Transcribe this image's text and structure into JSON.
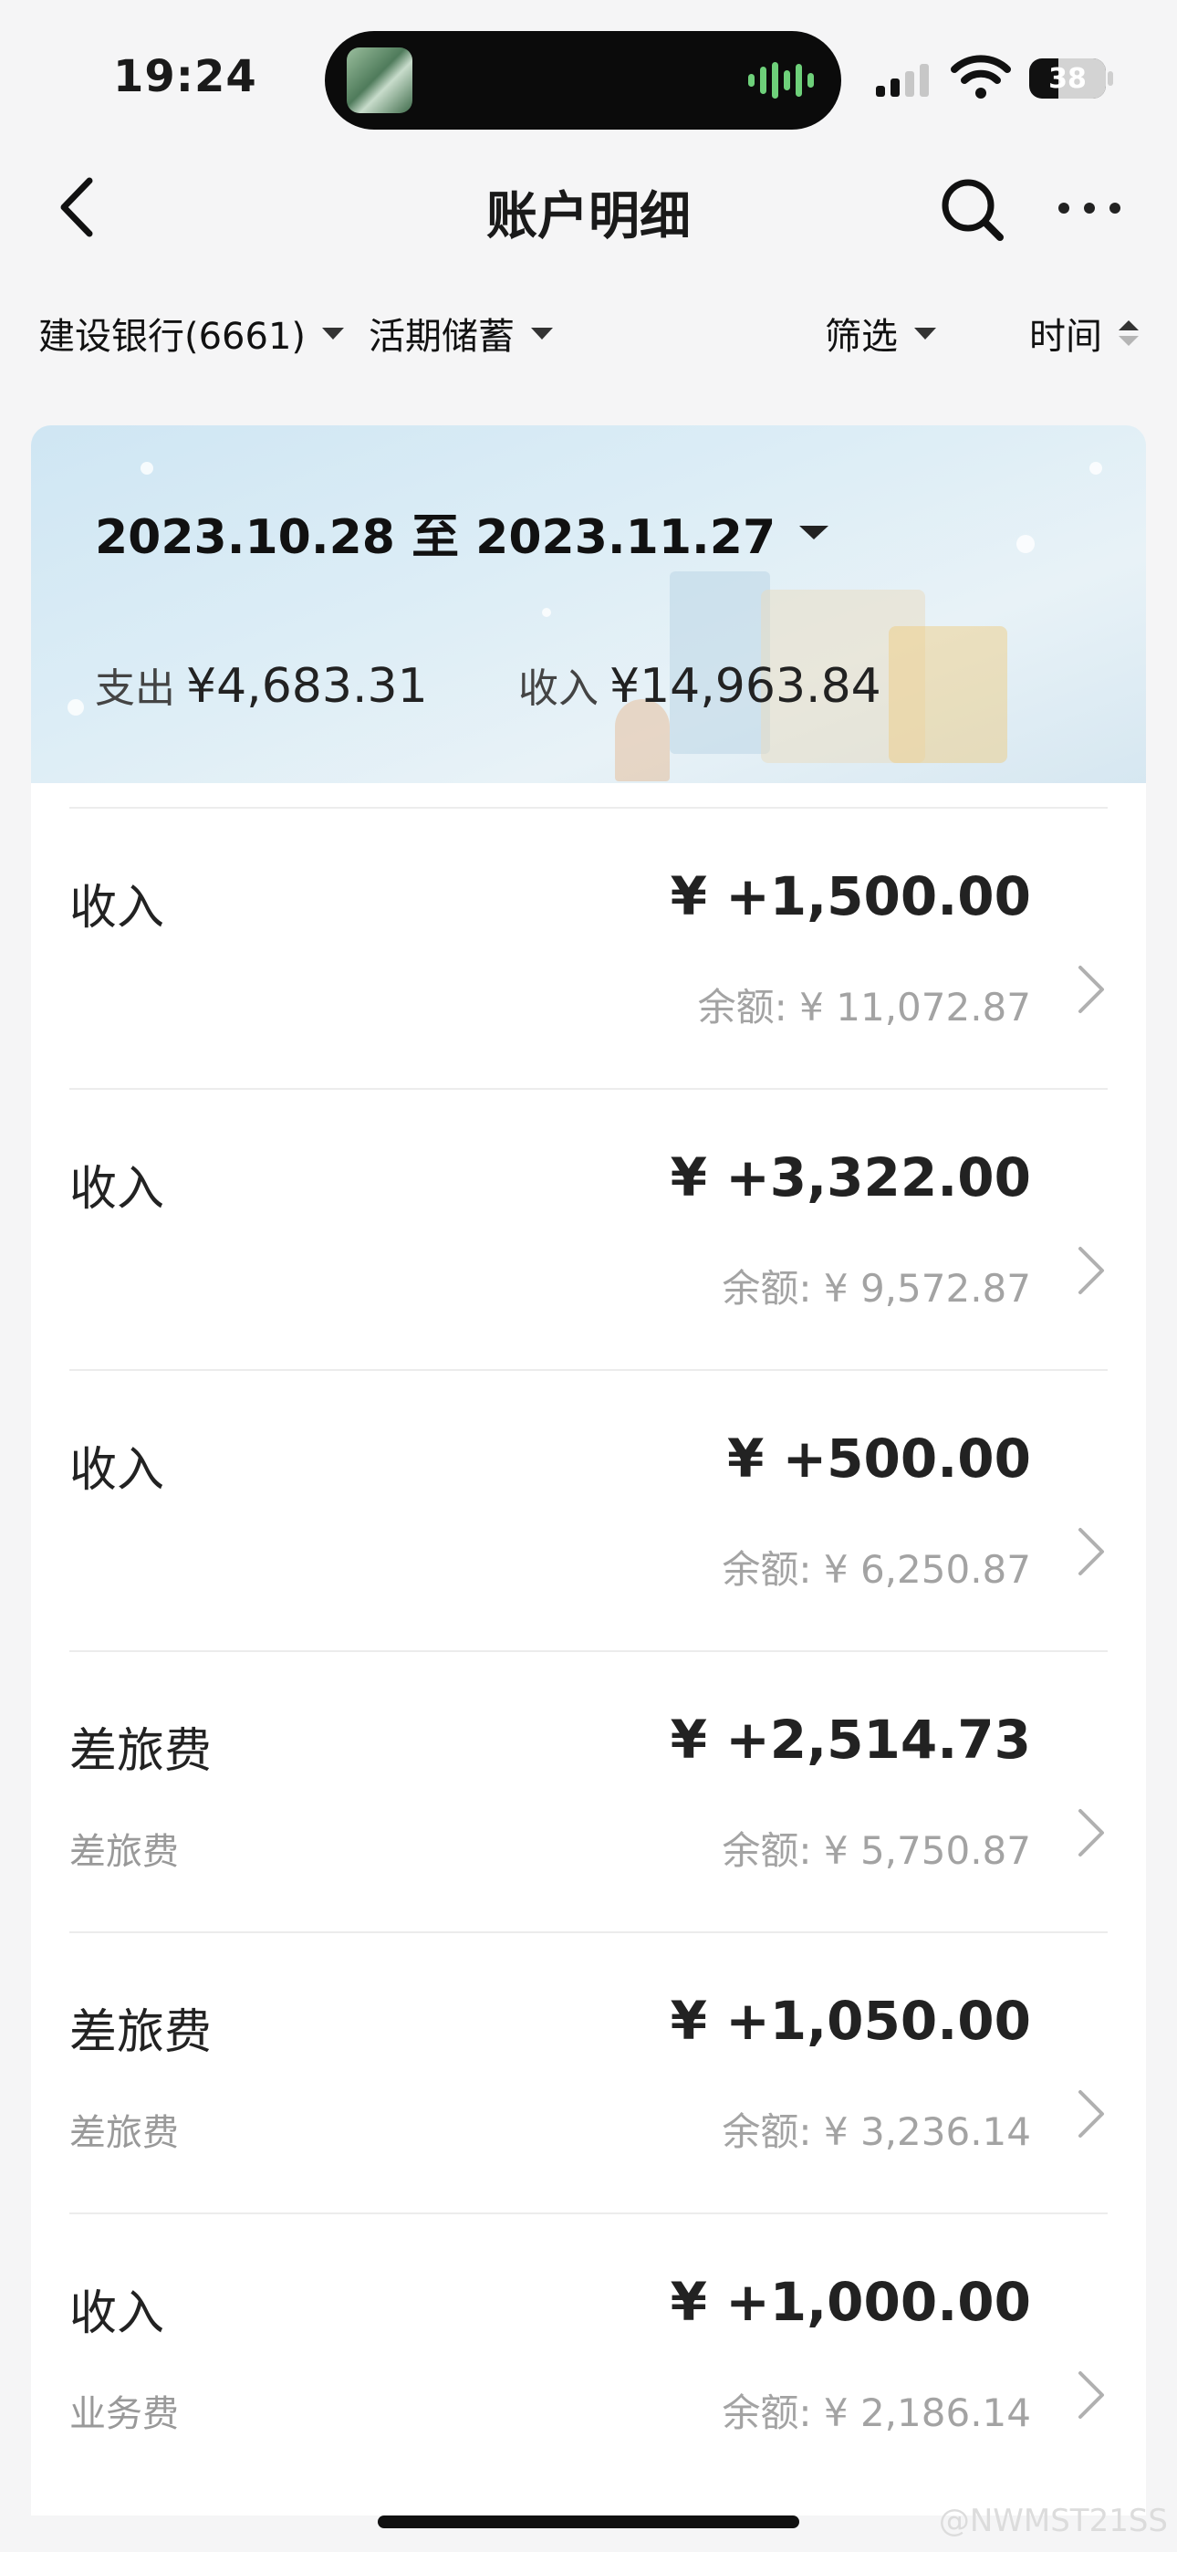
{
  "status": {
    "time": "19:24",
    "battery": "38",
    "battery_level": 0.38
  },
  "nav": {
    "title": "账户明细",
    "back_icon": "chevron-left-icon",
    "search_icon": "search-icon",
    "more_icon": "more-dots-icon"
  },
  "filters": {
    "account": "建设银行(6661)",
    "type": "活期储蓄",
    "filter": "筛选",
    "sort": "时间"
  },
  "summary": {
    "range": "2023.10.28 至 2023.11.27",
    "expense_label": "支出",
    "expense": "¥4,683.31",
    "income_label": "收入",
    "income": "¥14,963.84"
  },
  "transactions": [
    {
      "category": "收入",
      "sub": "",
      "amount": "¥ +1,500.00",
      "balance": "余额: ¥ 11,072.87"
    },
    {
      "category": "收入",
      "sub": "",
      "amount": "¥ +3,322.00",
      "balance": "余额: ¥ 9,572.87"
    },
    {
      "category": "收入",
      "sub": "",
      "amount": "¥ +500.00",
      "balance": "余额: ¥ 6,250.87"
    },
    {
      "category": "差旅费",
      "sub": "差旅费",
      "amount": "¥ +2,514.73",
      "balance": "余额: ¥ 5,750.87"
    },
    {
      "category": "差旅费",
      "sub": "差旅费",
      "amount": "¥ +1,050.00",
      "balance": "余额: ¥ 3,236.14"
    },
    {
      "category": "收入",
      "sub": "业务费",
      "amount": "¥ +1,000.00",
      "balance": "余额: ¥ 2,186.14"
    }
  ],
  "watermark": "@NWMST21SS",
  "colors": {
    "background": "#f5f5f6",
    "card": "#ffffff",
    "muted": "#a3a3a3",
    "banner": "#d6e7f1"
  }
}
